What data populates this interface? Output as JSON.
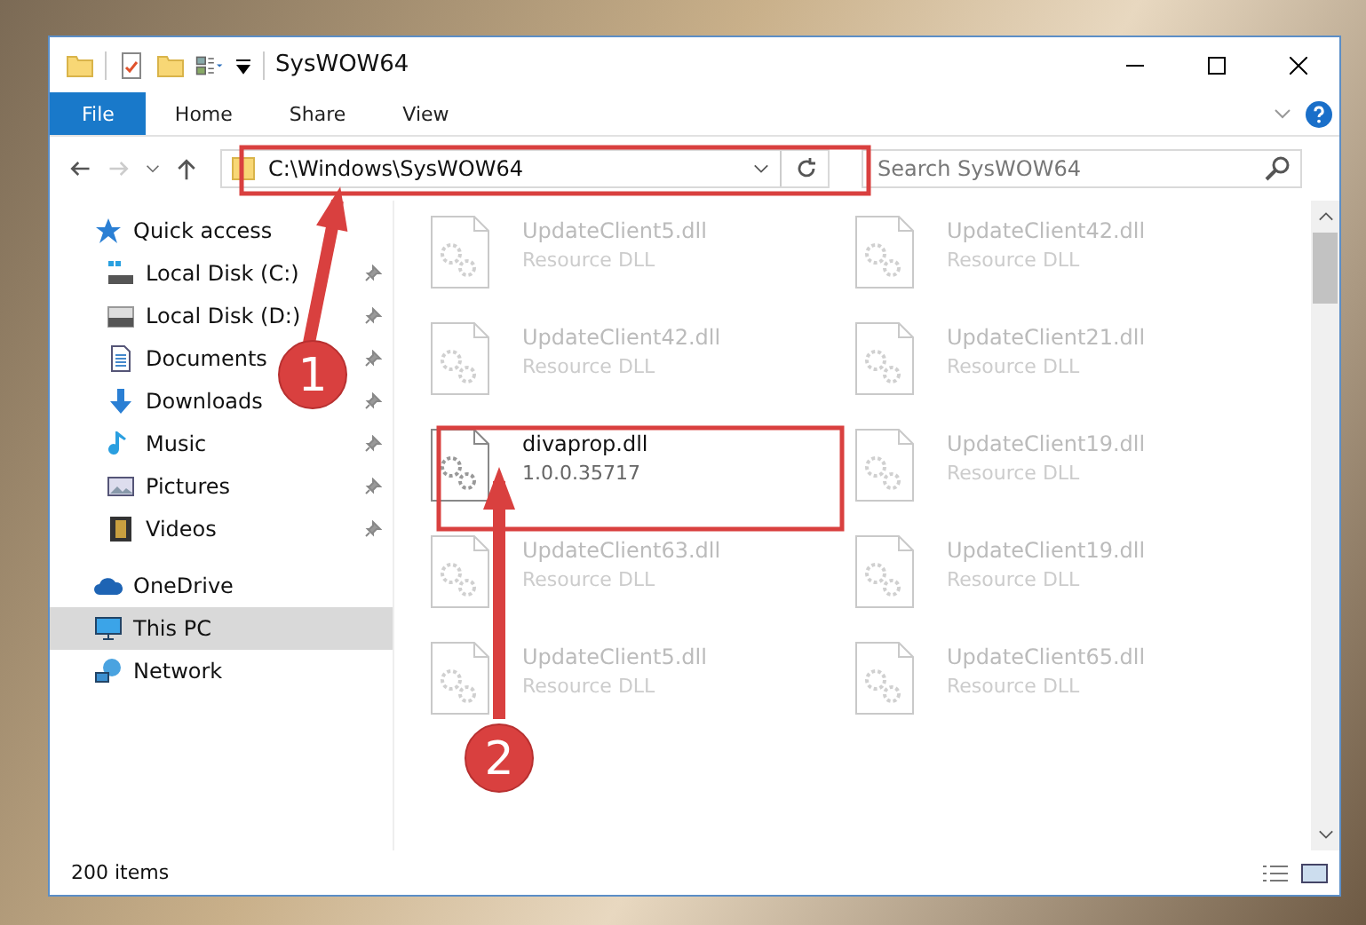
{
  "window": {
    "title": "SysWOW64"
  },
  "ribbon": {
    "tabs": [
      {
        "label": "File",
        "selected": true
      },
      {
        "label": "Home",
        "selected": false
      },
      {
        "label": "Share",
        "selected": false
      },
      {
        "label": "View",
        "selected": false
      }
    ]
  },
  "address_bar": {
    "path": "C:\\Windows\\SysWOW64"
  },
  "search": {
    "placeholder": "Search SysWOW64"
  },
  "sidebar": {
    "items": [
      {
        "label": "Quick access",
        "kind": "star",
        "selected": false,
        "children": [
          {
            "label": "Local Disk (C:)",
            "kind": "systemdrive",
            "pinned": true
          },
          {
            "label": "Local Disk (D:)",
            "kind": "drive",
            "pinned": true
          },
          {
            "label": "Documents",
            "kind": "document",
            "pinned": true
          },
          {
            "label": "Downloads",
            "kind": "download",
            "pinned": true
          },
          {
            "label": "Music",
            "kind": "music",
            "pinned": true
          },
          {
            "label": "Pictures",
            "kind": "picture",
            "pinned": true
          },
          {
            "label": "Videos",
            "kind": "video",
            "pinned": true
          }
        ]
      },
      {
        "label": "OneDrive",
        "kind": "cloud",
        "selected": false
      },
      {
        "label": "This PC",
        "kind": "pc",
        "selected": true
      },
      {
        "label": "Network",
        "kind": "network",
        "selected": false
      }
    ]
  },
  "files": [
    {
      "name": "UpdateClient5.dll",
      "detail": "Resource DLL",
      "blurred": true
    },
    {
      "name": "UpdateClient42.dll",
      "detail": "Resource DLL",
      "blurred": true
    },
    {
      "name": "UpdateClient42.dll",
      "detail": "Resource DLL",
      "blurred": true
    },
    {
      "name": "UpdateClient21.dll",
      "detail": "Resource DLL",
      "blurred": true
    },
    {
      "name": "divaprop.dll",
      "detail": "1.0.0.35717",
      "blurred": false
    },
    {
      "name": "UpdateClient19.dll",
      "detail": "Resource DLL",
      "blurred": true
    },
    {
      "name": "UpdateClient63.dll",
      "detail": "Resource DLL",
      "blurred": true
    },
    {
      "name": "UpdateClient19.dll",
      "detail": "Resource DLL",
      "blurred": true
    },
    {
      "name": "UpdateClient5.dll",
      "detail": "Resource DLL",
      "blurred": true
    },
    {
      "name": "UpdateClient65.dll",
      "detail": "Resource DLL",
      "blurred": true
    }
  ],
  "status_bar": {
    "item_count": "200 items"
  },
  "annotations": [
    {
      "label": "1"
    },
    {
      "label": "2"
    }
  ]
}
